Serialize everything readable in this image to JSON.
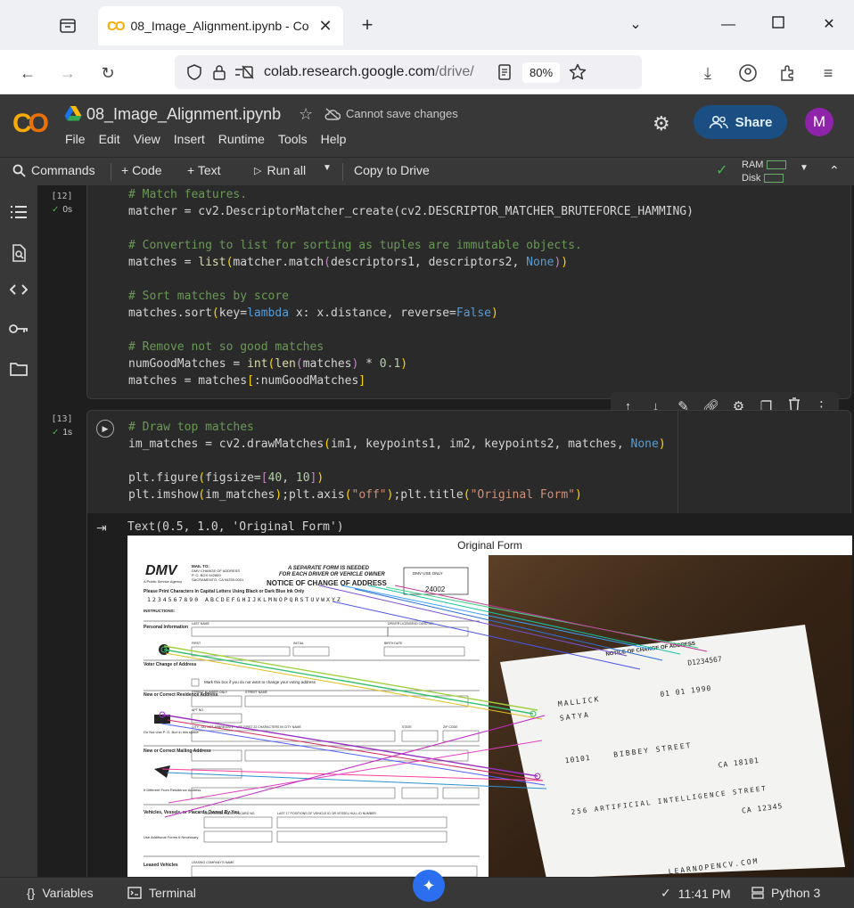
{
  "browser": {
    "tab_title": "08_Image_Alignment.ipynb - Co",
    "url_domain": "colab.research.google.com",
    "url_path": "/drive/",
    "zoom": "80%"
  },
  "colab": {
    "notebook_title": "08_Image_Alignment.ipynb",
    "save_status": "Cannot save changes",
    "menus": [
      "File",
      "Edit",
      "View",
      "Insert",
      "Runtime",
      "Tools",
      "Help"
    ],
    "share_label": "Share",
    "avatar_initial": "M"
  },
  "toolbar": {
    "commands": "Commands",
    "code": "+ Code",
    "text": "+ Text",
    "run_all": "Run all",
    "copy_to_drive": "Copy to Drive",
    "ram": "RAM",
    "disk": "Disk"
  },
  "cells": {
    "cell12": {
      "number": "[12]",
      "time": "0s"
    },
    "cell13": {
      "number": "[13]",
      "time": "1s"
    }
  },
  "output": {
    "text": "Text(0.5, 1.0, 'Original Form')",
    "plot_title": "Original Form",
    "form": {
      "mail_to": "MAIL TO:",
      "dmv_addr": "DMV CHANGE OF ADDRESS",
      "po_box": "P. O. BOX 942859",
      "city": "SACRAMENTO, CA 94259-0001",
      "agency": "A Public Service Agency",
      "separate": "A SEPARATE FORM IS NEEDED",
      "each": "FOR EACH DRIVER OR VEHICLE OWNER",
      "notice": "NOTICE OF CHANGE OF ADDRESS",
      "form_no": "24002",
      "dmv_use": "DMV USE ONLY",
      "print_chars": "Please Print Characters In Capital Letters Using Black or Dark Blue Ink Only",
      "sample": "1234567890 ABCDEFGHIJKLMNOPQRSTUVWXYZ",
      "instructions": "INSTRUCTIONS:",
      "personal": "Personal Information",
      "last_name": "LAST NAME",
      "first": "FIRST",
      "initial": "INITIAL",
      "birth_date": "BIRTH DATE",
      "drivers_license": "DRIVER LICENSE/ID CARD NO.",
      "voter": "Voter Change of Address",
      "mark_box": "Mark this box if you do not want to change your voting address",
      "new_residence": "New or Correct Residence Address",
      "street_number": "STREET NUMBER ONLY",
      "street_name": "STREET NAME",
      "apt": "APT NO.",
      "city_label": "CITY - DO NOT ABBREVIATE - USE FIRST 22 CHARACTERS IN CITY NAME",
      "state": "STATE",
      "zip": "ZIP CODE",
      "po_note": "Do Not Use P. O. Box in this space",
      "new_mailing": "New or Correct Mailing Address",
      "different": "If Different From Residence Address",
      "vehicles": "Vehicles, Vessels, or Placards Owned By You",
      "plate": "CALIFORNIA PLATE/PLACARD NO.",
      "vin": "LAST 17 POSITIONS OF VEHICLE ID OR VESSEL HULL ID NUMBER",
      "leased": "Leased Vehicles",
      "leasing": "LEASING COMPANY'S NAME",
      "use_additional": "Use Additional Forms If Necessary"
    },
    "photo_handwriting": {
      "license": "D1234567",
      "last": "MALLICK",
      "first": "SATYA",
      "birth": "01 01 1990",
      "street_num": "10101",
      "street": "BIBBEY STREET",
      "city": "CA 18101",
      "mailing_street": "256 ARTIFICIAL INTELLIGENCE STREET",
      "mailing_zip": "CA 12345",
      "footer": "LEARNOPENCV.COM"
    }
  },
  "statusbar": {
    "variables": "Variables",
    "terminal": "Terminal",
    "time": "11:41 PM",
    "runtime": "Python 3"
  },
  "colors": {
    "browser_chrome": "#eef0f4",
    "colab_bar": "#383838",
    "notebook_bg": "#1e1e1e",
    "share_blue": "#1b4e83",
    "avatar_purple": "#8e24aa",
    "success_green": "#4caf50"
  }
}
